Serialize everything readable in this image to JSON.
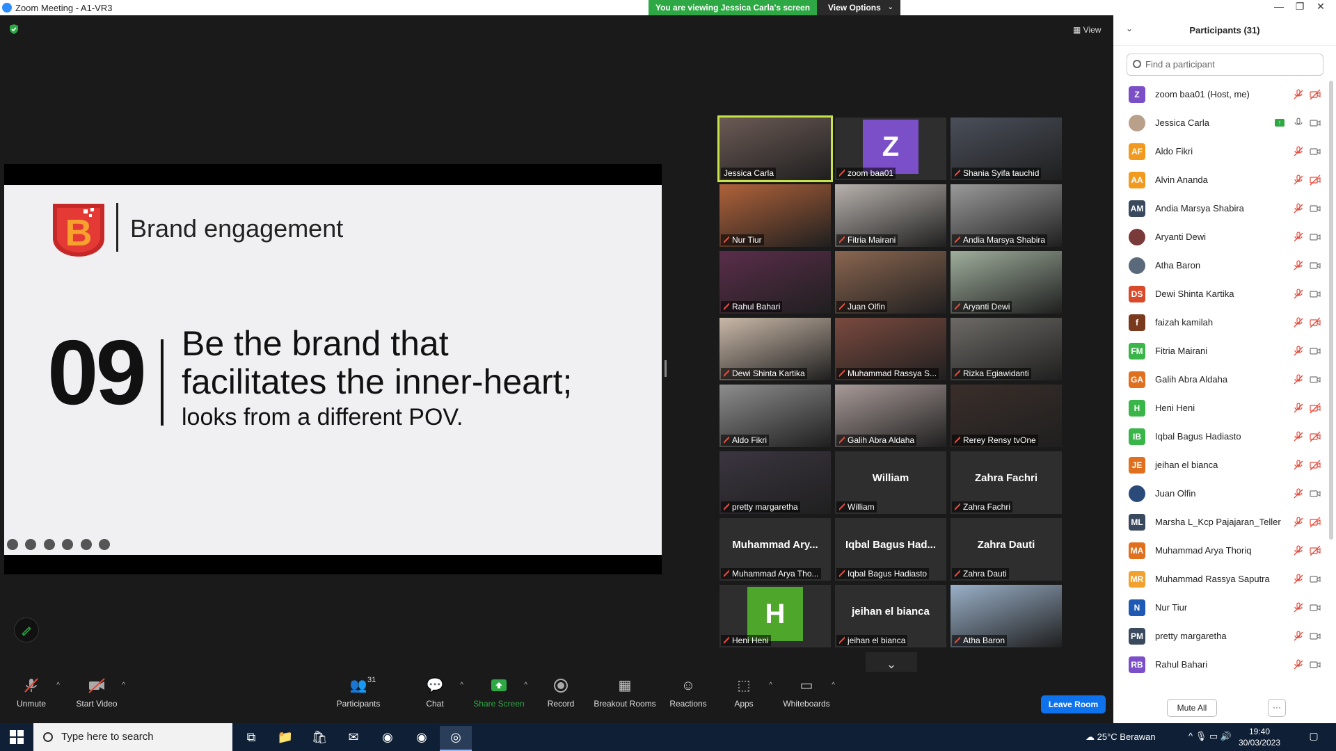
{
  "window": {
    "title": "Zoom Meeting - A1-VR3",
    "controls": [
      "—",
      "❐",
      "✕"
    ]
  },
  "banner": {
    "viewing_text": "You are viewing Jessica Carla's screen",
    "view_options_label": "View Options"
  },
  "view_button_label": "View",
  "slide": {
    "title": "Brand engagement",
    "number": "09",
    "line1": "Be the brand that",
    "line2": "facilitates the inner-heart;",
    "line3": "looks from a different POV."
  },
  "gallery": [
    {
      "name": "Jessica Carla",
      "type": "video",
      "speaking": true,
      "color": "#6b5a55"
    },
    {
      "name": "zoom baa01",
      "type": "avatar",
      "initial": "Z",
      "color": "#7b4fc8"
    },
    {
      "name": "Shania Syifa tauchid",
      "type": "video",
      "color": "#4a4f5a"
    },
    {
      "name": "Nur Tiur",
      "type": "video",
      "color": "#b0623a"
    },
    {
      "name": "Fitria Mairani",
      "type": "video",
      "color": "#b8b2ad"
    },
    {
      "name": "Andia Marsya Shabira",
      "type": "video",
      "color": "#9a9a9a"
    },
    {
      "name": "Rahul Bahari",
      "type": "video",
      "color": "#5a2d4a"
    },
    {
      "name": "Juan Olfin",
      "type": "video",
      "color": "#8a6650"
    },
    {
      "name": "Aryanti Dewi",
      "type": "video",
      "color": "#9fae9c"
    },
    {
      "name": "Dewi Shinta Kartika",
      "type": "video",
      "color": "#c9b8a8"
    },
    {
      "name": "Muhammad Rassya S...",
      "type": "video",
      "color": "#7a4a3f"
    },
    {
      "name": "Rizka Egiawidanti",
      "type": "video",
      "color": "#6d6a66"
    },
    {
      "name": "Aldo Fikri",
      "type": "video",
      "color": "#8d8d8d"
    },
    {
      "name": "Galih Abra Aldaha",
      "type": "video",
      "color": "#a89a98"
    },
    {
      "name": "Rerey Rensy tvOne",
      "type": "video",
      "color": "#3a2e2a"
    },
    {
      "name": "pretty margaretha",
      "type": "video",
      "color": "#3b3540"
    },
    {
      "name": "William",
      "type": "name",
      "display": "William"
    },
    {
      "name": "Zahra Fachri",
      "type": "name",
      "display": "Zahra Fachri"
    },
    {
      "name": "Muhammad Arya Tho...",
      "type": "name",
      "display": "Muhammad Ary..."
    },
    {
      "name": "Iqbal Bagus Hadiasto",
      "type": "name",
      "display": "Iqbal Bagus Had..."
    },
    {
      "name": "Zahra Dauti",
      "type": "name",
      "display": "Zahra Dauti"
    },
    {
      "name": "Heni Heni",
      "type": "avatar",
      "initial": "H",
      "color": "#4ea62b"
    },
    {
      "name": "jeihan el bianca",
      "type": "name",
      "display": "jeihan el bianca"
    },
    {
      "name": "Atha Baron",
      "type": "video",
      "color": "#9ab0c8"
    }
  ],
  "gallery_next_icon": "chevron-down-icon",
  "toolbar": {
    "unmute": "Unmute",
    "start_video": "Start Video",
    "participants": "Participants",
    "participants_count": "31",
    "chat": "Chat",
    "share_screen": "Share Screen",
    "record": "Record",
    "breakout": "Breakout Rooms",
    "reactions": "Reactions",
    "apps": "Apps",
    "whiteboards": "Whiteboards",
    "leave": "Leave Room"
  },
  "panel": {
    "title": "Participants (31)",
    "search_placeholder": "Find a participant",
    "mute_all": "Mute All",
    "more": "···",
    "participants": [
      {
        "name": "zoom baa01 (Host, me)",
        "initials": "Z",
        "color": "#7b4fc8",
        "mic": "muted",
        "video": "off"
      },
      {
        "name": "Jessica Carla",
        "initials": "",
        "color": "#b9a08a",
        "mic": "on",
        "video": "on",
        "sharing": true
      },
      {
        "name": "Aldo Fikri",
        "initials": "AF",
        "color": "#f29a1e",
        "mic": "muted",
        "video": "on"
      },
      {
        "name": "Alvin Ananda",
        "initials": "AA",
        "color": "#f29a1e",
        "mic": "muted",
        "video": "off"
      },
      {
        "name": "Andia Marsya Shabira",
        "initials": "AM",
        "color": "#3a4a5e",
        "mic": "muted",
        "video": "on"
      },
      {
        "name": "Aryanti Dewi",
        "initials": "",
        "color": "#7a3a3a",
        "mic": "muted",
        "video": "on"
      },
      {
        "name": "Atha Baron",
        "initials": "",
        "color": "#5a6a7a",
        "mic": "muted",
        "video": "on"
      },
      {
        "name": "Dewi Shinta Kartika",
        "initials": "DS",
        "color": "#d84a2a",
        "mic": "muted",
        "video": "on"
      },
      {
        "name": "faizah kamilah",
        "initials": "f",
        "color": "#7a3a1e",
        "mic": "muted",
        "video": "off"
      },
      {
        "name": "Fitria Mairani",
        "initials": "FM",
        "color": "#3ab54a",
        "mic": "muted",
        "video": "on"
      },
      {
        "name": "Galih Abra Aldaha",
        "initials": "GA",
        "color": "#e0701e",
        "mic": "muted",
        "video": "on"
      },
      {
        "name": "Heni Heni",
        "initials": "H",
        "color": "#3ab54a",
        "mic": "muted",
        "video": "off"
      },
      {
        "name": "Iqbal Bagus Hadiasto",
        "initials": "IB",
        "color": "#3ab54a",
        "mic": "muted",
        "video": "off"
      },
      {
        "name": "jeihan el bianca",
        "initials": "JE",
        "color": "#e0701e",
        "mic": "muted",
        "video": "off"
      },
      {
        "name": "Juan Olfin",
        "initials": "",
        "color": "#2a4a7a",
        "mic": "muted",
        "video": "on"
      },
      {
        "name": "Marsha L_Kcp Pajajaran_Teller",
        "initials": "ML",
        "color": "#3a4a5e",
        "mic": "muted",
        "video": "off"
      },
      {
        "name": "Muhammad Arya Thoriq",
        "initials": "MA",
        "color": "#e0701e",
        "mic": "muted",
        "video": "off"
      },
      {
        "name": "Muhammad Rassya Saputra",
        "initials": "MR",
        "color": "#f2a12e",
        "mic": "muted",
        "video": "on"
      },
      {
        "name": "Nur Tiur",
        "initials": "N",
        "color": "#1e5ab4",
        "mic": "muted",
        "video": "on"
      },
      {
        "name": "pretty margaretha",
        "initials": "PM",
        "color": "#3a4a5e",
        "mic": "muted",
        "video": "on"
      },
      {
        "name": "Rahul Bahari",
        "initials": "RB",
        "color": "#7b4fc8",
        "mic": "muted",
        "video": "on"
      }
    ]
  },
  "taskbar": {
    "search_placeholder": "Type here to search",
    "weather": "25°C  Berawan",
    "time": "19:40",
    "date": "30/03/2023",
    "apps": [
      "task-view-icon",
      "file-explorer-icon",
      "store-icon",
      "mail-icon",
      "chrome-icon",
      "chrome-profile-icon",
      "zoom-icon"
    ]
  },
  "colors": {
    "accent": "#0e72ed",
    "share_green": "#2ea844",
    "muted_red": "#e64a3c",
    "speaker_outline": "#c8e34a"
  }
}
